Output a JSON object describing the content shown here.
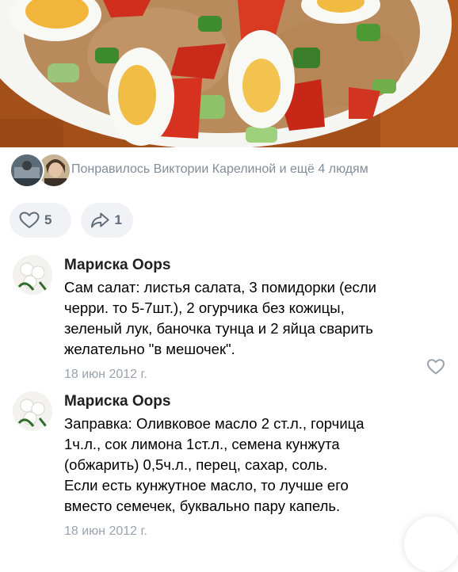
{
  "likes": {
    "text": "Понравилось Виктории Карелиной и ещё 4 людям"
  },
  "actions": {
    "like_count": "5",
    "share_count": "1"
  },
  "comments": [
    {
      "author": "Мариска Oops",
      "text": "Сам салат: листья салата, 3 помидорки (если\nчерри. то 5-7шт.), 2 огурчика без кожицы,\nзеленый лук, баночка тунца и 2 яйца сварить\nжелательно \"в мешочек\".",
      "date": "18 июн 2012 г."
    },
    {
      "author": "Мариска Oops",
      "text": "Заправка: Оливковое масло 2 ст.л., горчица\n1ч.л., сок лимона 1ст.л., семена кунжута\n(обжарить) 0,5ч.л., перец, сахар, соль.\nЕсли есть кунжутное масло, то лучше его\nвместо семечек, буквально пару капель.",
      "date": "18 июн 2012 г."
    }
  ],
  "colors": {
    "secondary_text": "#818c99",
    "date_text": "#99a2ad",
    "pill_bg": "#f0f2f5",
    "icon": "#5f6b7a"
  }
}
